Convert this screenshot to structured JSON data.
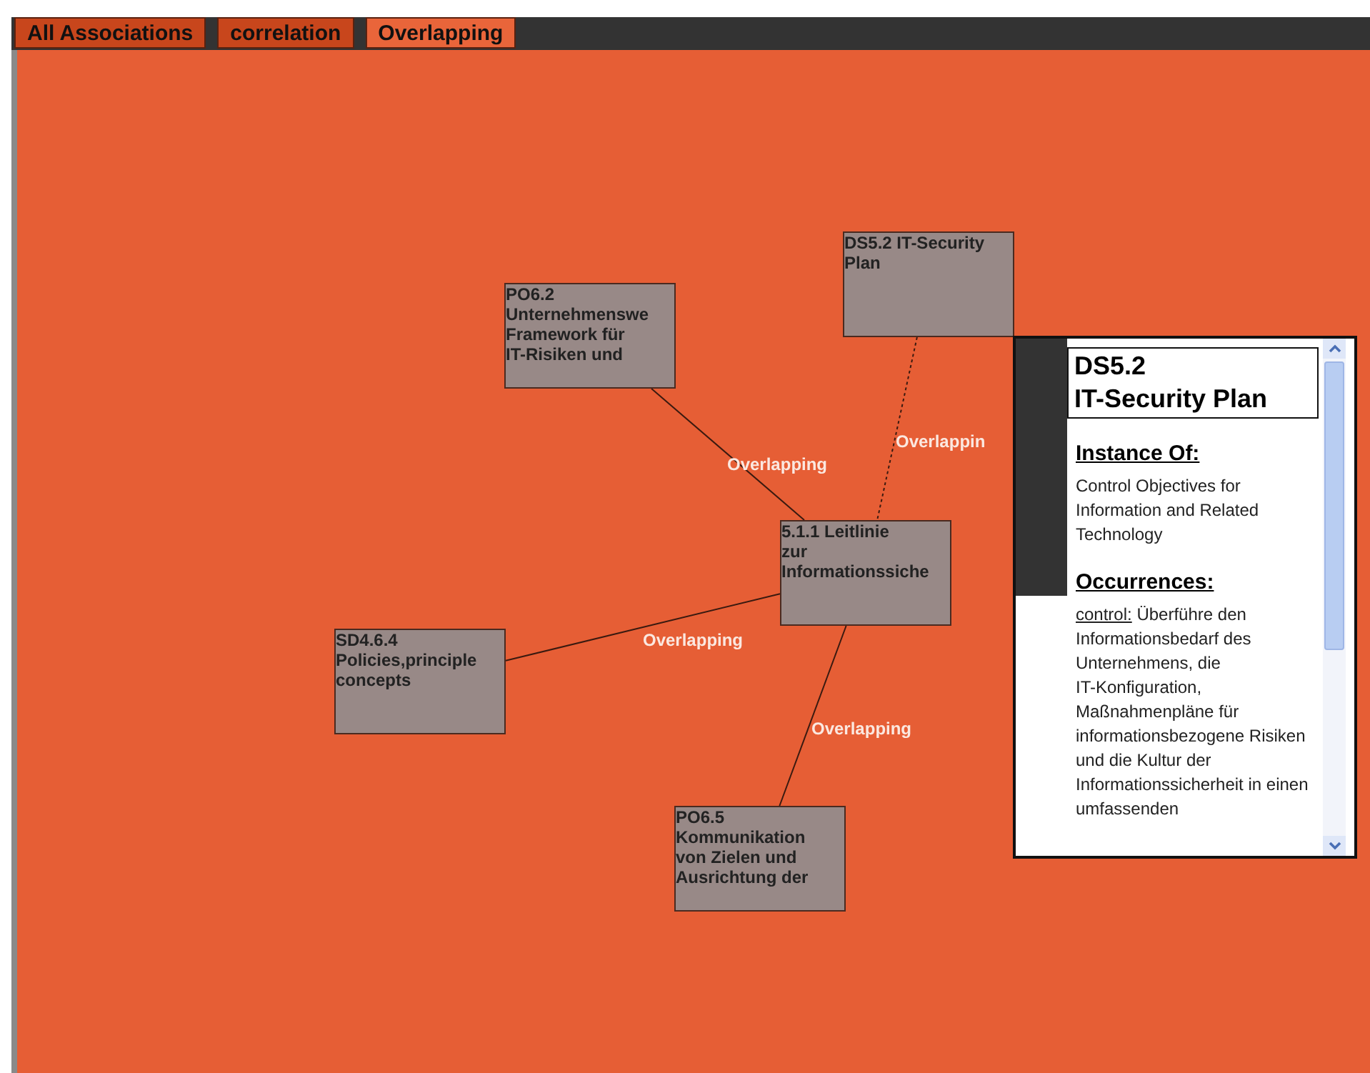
{
  "tabs": [
    {
      "label": "All Associations",
      "selected": false
    },
    {
      "label": "correlation",
      "selected": false
    },
    {
      "label": "Overlapping",
      "selected": true
    }
  ],
  "graph": {
    "nodes": [
      {
        "label": "DS5.2 IT-Security\nPlan"
      },
      {
        "label": "PO6.2\nUnternehmenswe\nFramework für\nIT-Risiken und"
      },
      {
        "label": "5.1.1 Leitlinie\nzur\nInformationssiche"
      },
      {
        "label": "SD4.6.4\nPolicies,principle\nconcepts"
      },
      {
        "label": "PO6.5\nKommunikation\nvon Zielen und\nAusrichtung der"
      }
    ],
    "edges": [
      {
        "label": "Overlapping",
        "kind": "solid"
      },
      {
        "label": "Overlappin",
        "kind": "dotted"
      },
      {
        "label": "Overlapping",
        "kind": "solid"
      },
      {
        "label": "Overlapping",
        "kind": "solid"
      }
    ]
  },
  "details": {
    "title": "DS5.2\nIT-Security Plan",
    "instance_heading": "Instance Of:",
    "instance_text": "Control Objectives for Information and Related Technology",
    "occurrences_heading": "Occurrences:",
    "occurrence": {
      "type": "control:",
      "text": "Überführe den Informationsbedarf des Unternehmens, die IT-Konfiguration, Maßnahmenpläne für informationsbezogene Risiken und die Kultur der Informationssicherheit in einen umfassenden"
    }
  }
}
